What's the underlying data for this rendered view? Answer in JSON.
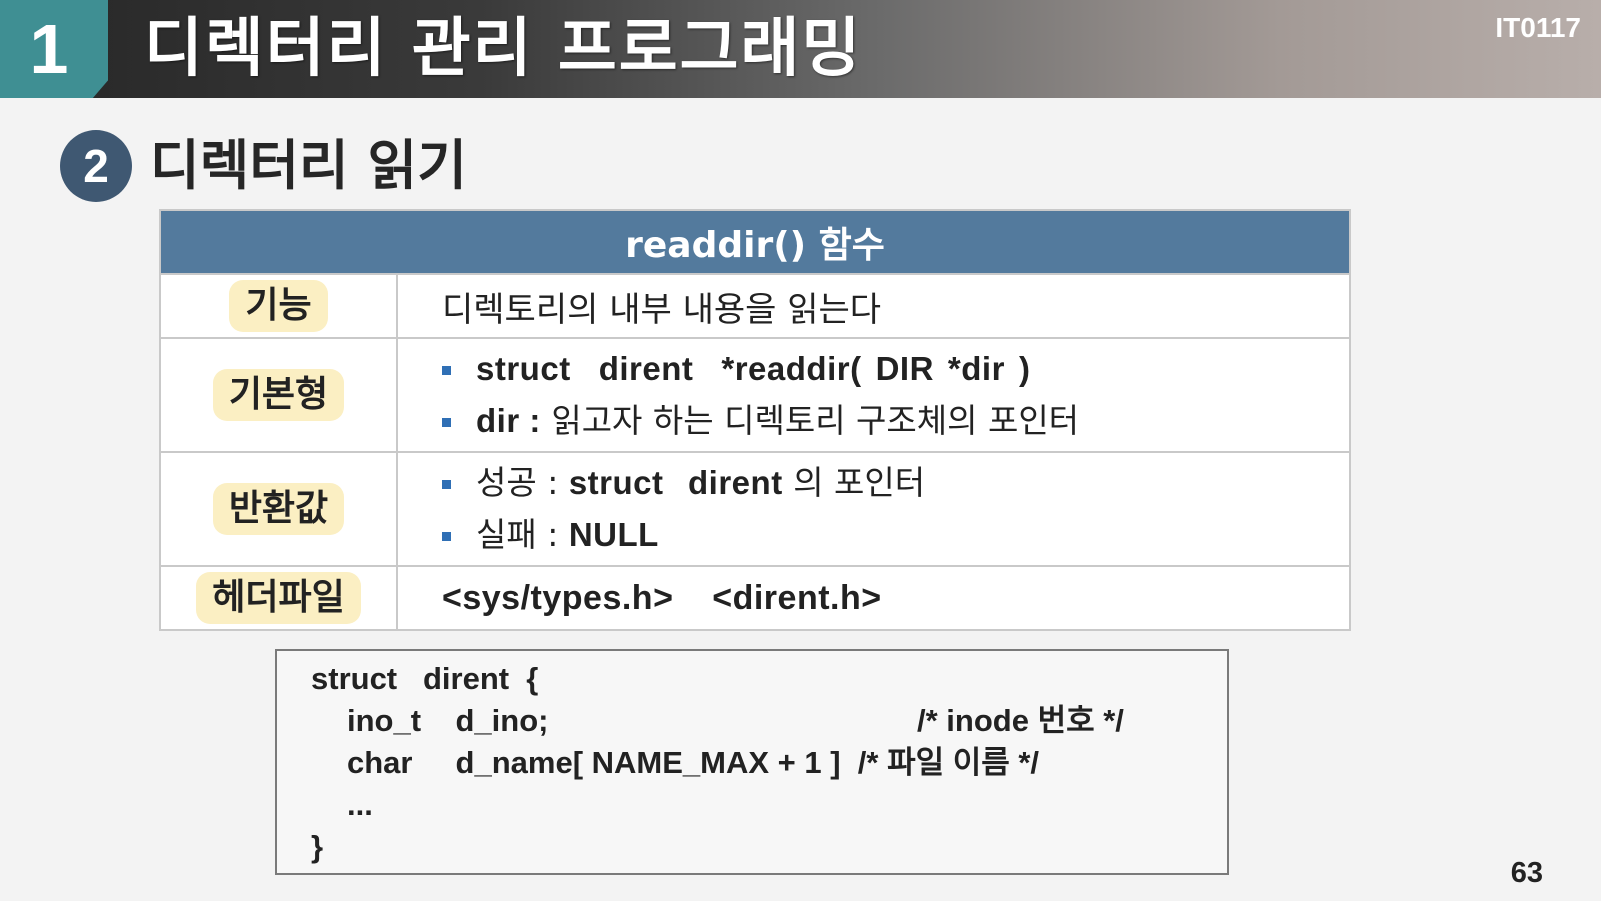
{
  "header": {
    "chapter_number": "1",
    "chapter_title": "디렉터리 관리 프로그래밍",
    "course_code": "IT0117"
  },
  "section": {
    "number": "2",
    "title": "디렉터리 읽기"
  },
  "table": {
    "heading": "readdir() 함수",
    "rows": [
      {
        "label": "기능",
        "content": "디렉토리의 내부 내용을 읽는다"
      },
      {
        "label": "기본형",
        "bullets": [
          {
            "prefix": "struct",
            "p2": "dirent",
            "p3": "*readdir(",
            "p4": "DIR",
            "p5": "*dir",
            "p6": ")"
          },
          {
            "prefix": "dir :",
            "text": "읽고자 하는 디렉토리 구조체의 포인터"
          }
        ]
      },
      {
        "label": "반환값",
        "bullets": [
          {
            "prefix": "성공 :",
            "p2": "struct",
            "p3": "dirent",
            "text": "의 포인터"
          },
          {
            "prefix": "실패 :",
            "p2": "NULL"
          }
        ]
      },
      {
        "label": "헤더파일",
        "content_a": "<sys/types.h>",
        "content_b": "<dirent.h>"
      }
    ]
  },
  "code_box": {
    "line1": "struct   dirent  {",
    "line2_a": "ino_t    d_ino;",
    "line2_b": "/* inode 번호 */",
    "line3_a": "char     d_name[ NAME_MAX + 1 ]  /* 파일 이름 */",
    "line4": "...",
    "line5": "}"
  },
  "page_number": "63"
}
